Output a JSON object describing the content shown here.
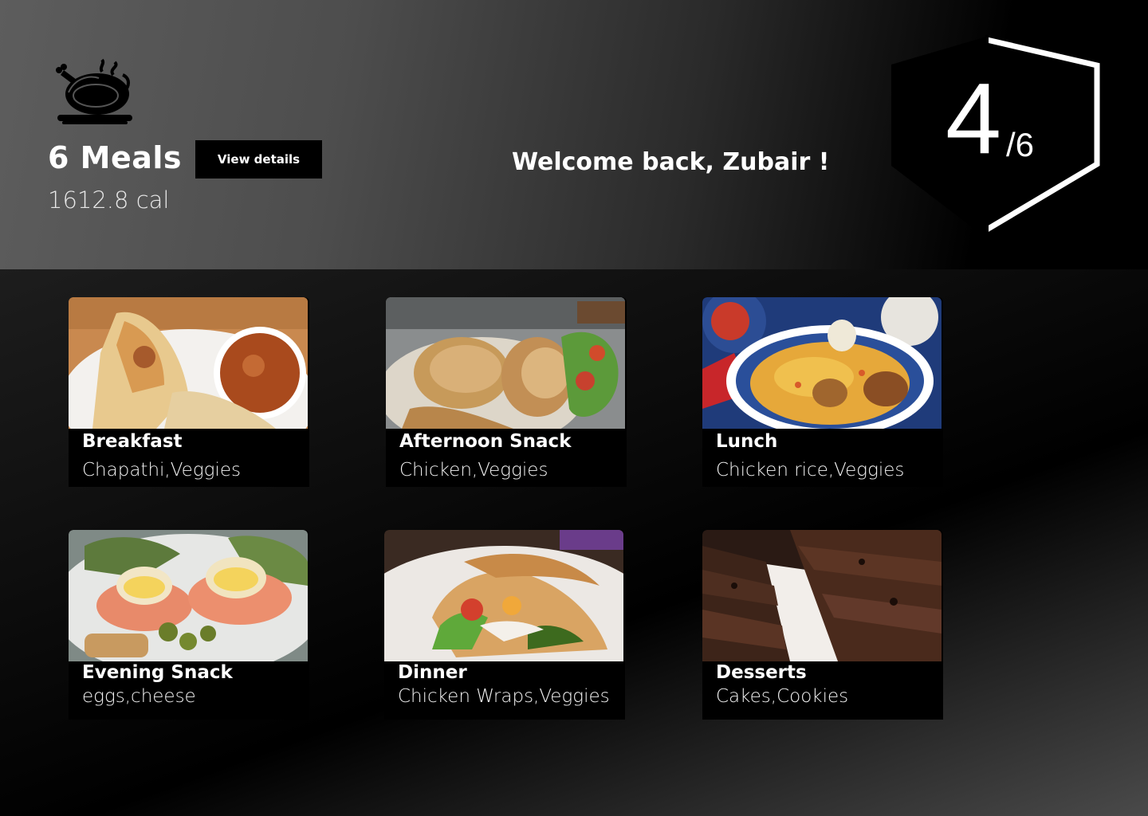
{
  "summary": {
    "meals_count": "6 Meals",
    "calories": "1612.8 cal",
    "view_details_label": "View details",
    "welcome": "Welcome back, Zubair !"
  },
  "progress": {
    "current": "4",
    "total": "/6",
    "value": 4,
    "max": 6
  },
  "logo": {
    "icon": "roast-chicken-icon"
  },
  "meals": [
    {
      "title": "Breakfast",
      "items": "Chapathi,Veggies",
      "image": "wrap-with-sauce-photo"
    },
    {
      "title": "Afternoon Snack",
      "items": "Chicken,Veggies",
      "image": "roast-chicken-photo"
    },
    {
      "title": "Lunch",
      "items": "Chicken rice,Veggies",
      "image": "chicken-rice-plate-photo"
    },
    {
      "title": "Evening Snack",
      "items": "eggs,cheese",
      "image": "eggs-benedict-photo"
    },
    {
      "title": "Dinner",
      "items": "Chicken Wraps,Veggies",
      "image": "chicken-wrap-photo"
    },
    {
      "title": "Desserts",
      "items": "Cakes,Cookies",
      "image": "brownie-cake-photo"
    }
  ],
  "colors": {
    "accent": "#ffffff",
    "button_bg": "#000000"
  }
}
